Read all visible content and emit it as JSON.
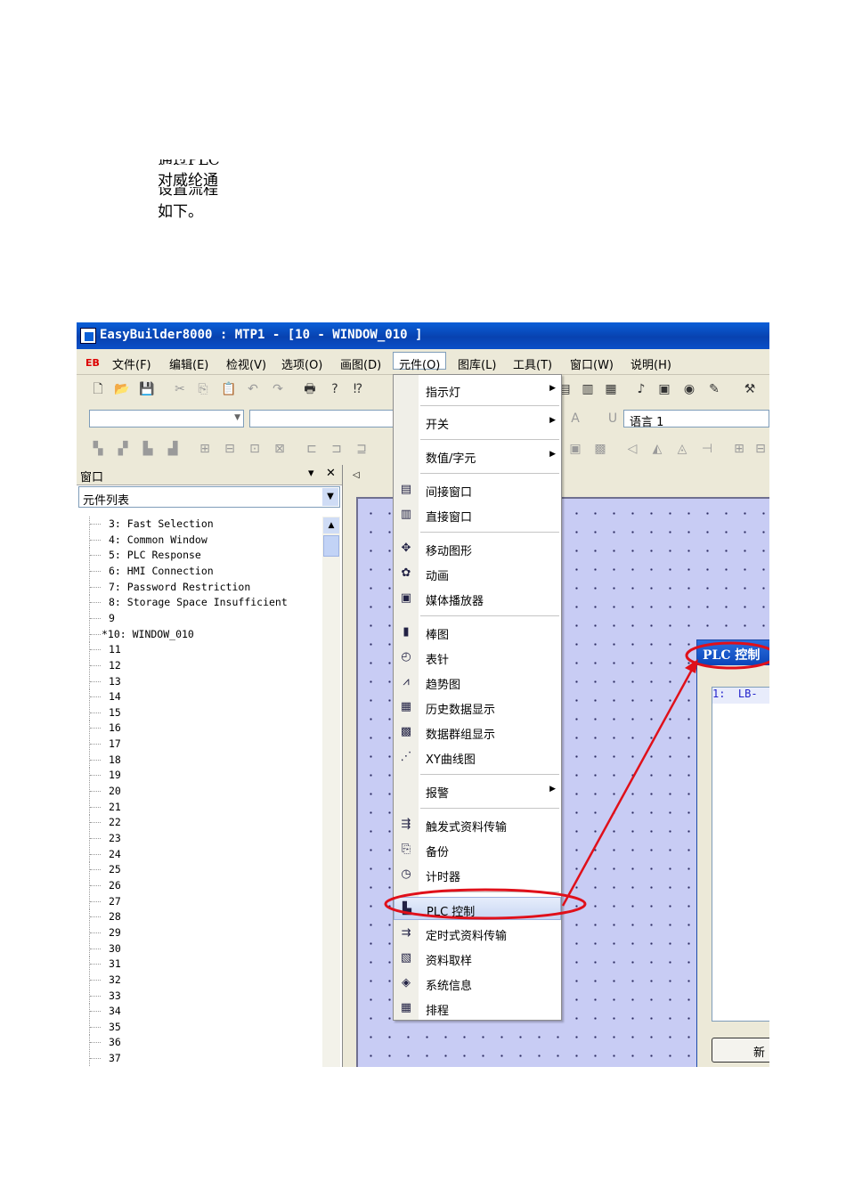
{
  "doc_text": {
    "line1": "通过PLC",
    "line2": "对威纶通",
    "line3": "设置流程",
    "line4": "如下。"
  },
  "window": {
    "title": "EasyBuilder8000 : MTP1 - [10 - WINDOW_010 ]"
  },
  "menubar": {
    "eb": "EB",
    "items": [
      "文件(F)",
      "编辑(E)",
      "检视(V)",
      "选项(O)",
      "画图(D)",
      "元件(O)",
      "图库(L)",
      "工具(T)",
      "窗口(W)",
      "说明(H)"
    ]
  },
  "toolbar3": {
    "language_label": "语言 1"
  },
  "panel": {
    "title": "窗口",
    "pin": "▾",
    "close": "✕",
    "selector": "元件列表",
    "items": [
      "3: Fast Selection",
      "4: Common Window",
      "5: PLC Response",
      "6: HMI Connection",
      "7: Password Restriction",
      "8: Storage Space Insufficient",
      "9",
      "*10: WINDOW_010",
      "11",
      "12",
      "13",
      "14",
      "15",
      "16",
      "17",
      "18",
      "19",
      "20",
      "21",
      "22",
      "23",
      "24",
      "25",
      "26",
      "27",
      "28",
      "29",
      "30",
      "31",
      "32",
      "33",
      "34",
      "35",
      "36",
      "37"
    ]
  },
  "dropdown": {
    "items": [
      {
        "label": "指示灯",
        "icon": "",
        "submenu": true
      },
      {
        "label": "开关",
        "icon": "",
        "submenu": true
      },
      {
        "label": "数值/字元",
        "icon": "",
        "submenu": true
      },
      {
        "label": "间接窗口",
        "icon": "indirect-window-icon"
      },
      {
        "label": "直接窗口",
        "icon": "direct-window-icon"
      },
      {
        "label": "移动图形",
        "icon": "moving-shape-icon"
      },
      {
        "label": "动画",
        "icon": "animation-icon"
      },
      {
        "label": "媒体播放器",
        "icon": "media-player-icon"
      },
      {
        "label": "棒图",
        "icon": "bar-graph-icon"
      },
      {
        "label": "表针",
        "icon": "meter-icon"
      },
      {
        "label": "趋势图",
        "icon": "trend-icon"
      },
      {
        "label": "历史数据显示",
        "icon": "history-data-icon"
      },
      {
        "label": "数据群组显示",
        "icon": "data-group-icon"
      },
      {
        "label": "XY曲线图",
        "icon": "xy-plot-icon"
      },
      {
        "label": "报警",
        "icon": "",
        "submenu": true
      },
      {
        "label": "触发式资料传输",
        "icon": "trigger-transfer-icon"
      },
      {
        "label": "备份",
        "icon": "backup-icon"
      },
      {
        "label": "计时器",
        "icon": "timer-icon"
      },
      {
        "label": "PLC 控制",
        "icon": "plc-control-icon",
        "highlight": true
      },
      {
        "label": "定时式资料传输",
        "icon": "timed-transfer-icon"
      },
      {
        "label": "资料取样",
        "icon": "data-sampling-icon"
      },
      {
        "label": "系统信息",
        "icon": "system-info-icon"
      },
      {
        "label": "排程",
        "icon": "schedule-icon"
      }
    ]
  },
  "dialog": {
    "title": "PLC 控制",
    "list_row": "1:  LB-",
    "new_button": "新"
  },
  "colors": {
    "titlebar": "#0a5fd8",
    "canvas": "#c8ccf4",
    "annotation": "#e0101a"
  }
}
